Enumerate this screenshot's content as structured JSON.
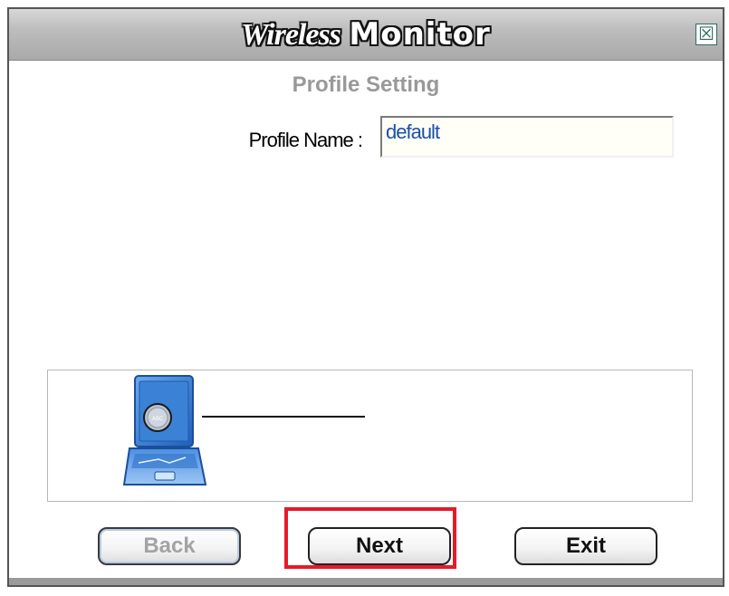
{
  "window": {
    "title_part1": "Wireless",
    "title_part2": "Monitor",
    "close_glyph": "☒",
    "close_icon": "close-icon"
  },
  "section": {
    "title": "Profile Setting"
  },
  "profile": {
    "label": "Profile Name :",
    "value": "default"
  },
  "illustration": {
    "icon": "laptop-icon",
    "badge_text": "ABC"
  },
  "buttons": {
    "back": "Back",
    "next": "Next",
    "exit": "Exit"
  },
  "colors": {
    "highlight": "#e51a2a",
    "input_text": "#1b4fa8",
    "section_title": "#999999",
    "laptop_blue": "#2f73c9"
  }
}
